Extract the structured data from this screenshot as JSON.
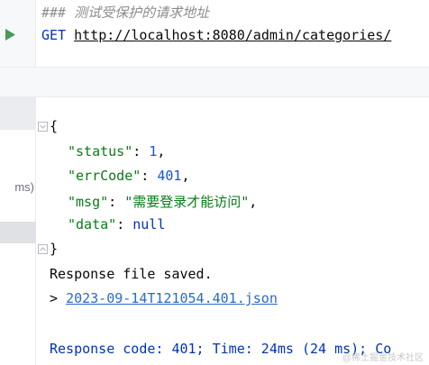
{
  "editor": {
    "comment": "### 测试受保护的请求地址",
    "method": "GET",
    "url": "http://localhost:8080/admin/categories/"
  },
  "history": {
    "clipped_label": "ms)"
  },
  "response": {
    "open_brace": "{",
    "close_brace": "}",
    "fields": [
      {
        "key": "\"status\"",
        "sep": ": ",
        "value": "1",
        "value_type": "num",
        "trail": ","
      },
      {
        "key": "\"errCode\"",
        "sep": ": ",
        "value": "401",
        "value_type": "num",
        "trail": ","
      },
      {
        "key": "\"msg\"",
        "sep": ": ",
        "value": "\"需要登录才能访问\"",
        "value_type": "str",
        "trail": ","
      },
      {
        "key": "\"data\"",
        "sep": ": ",
        "value": "null",
        "value_type": "kw",
        "trail": ""
      }
    ],
    "saved_text": "Response file saved.",
    "file_prefix": "> ",
    "file_link": "2023-09-14T121054.401.json",
    "summary": "Response code: 401; Time: 24ms (24 ms); Co"
  },
  "watermark": "@稀土掘金技术社区",
  "colors": {
    "run_green": "#499c54",
    "keyword_blue": "#0033b3",
    "string_green": "#067d17",
    "number_blue": "#1750eb",
    "link_blue": "#2a6ac7"
  },
  "icons": [
    "run-icon",
    "fold-open-icon",
    "fold-close-icon"
  ]
}
